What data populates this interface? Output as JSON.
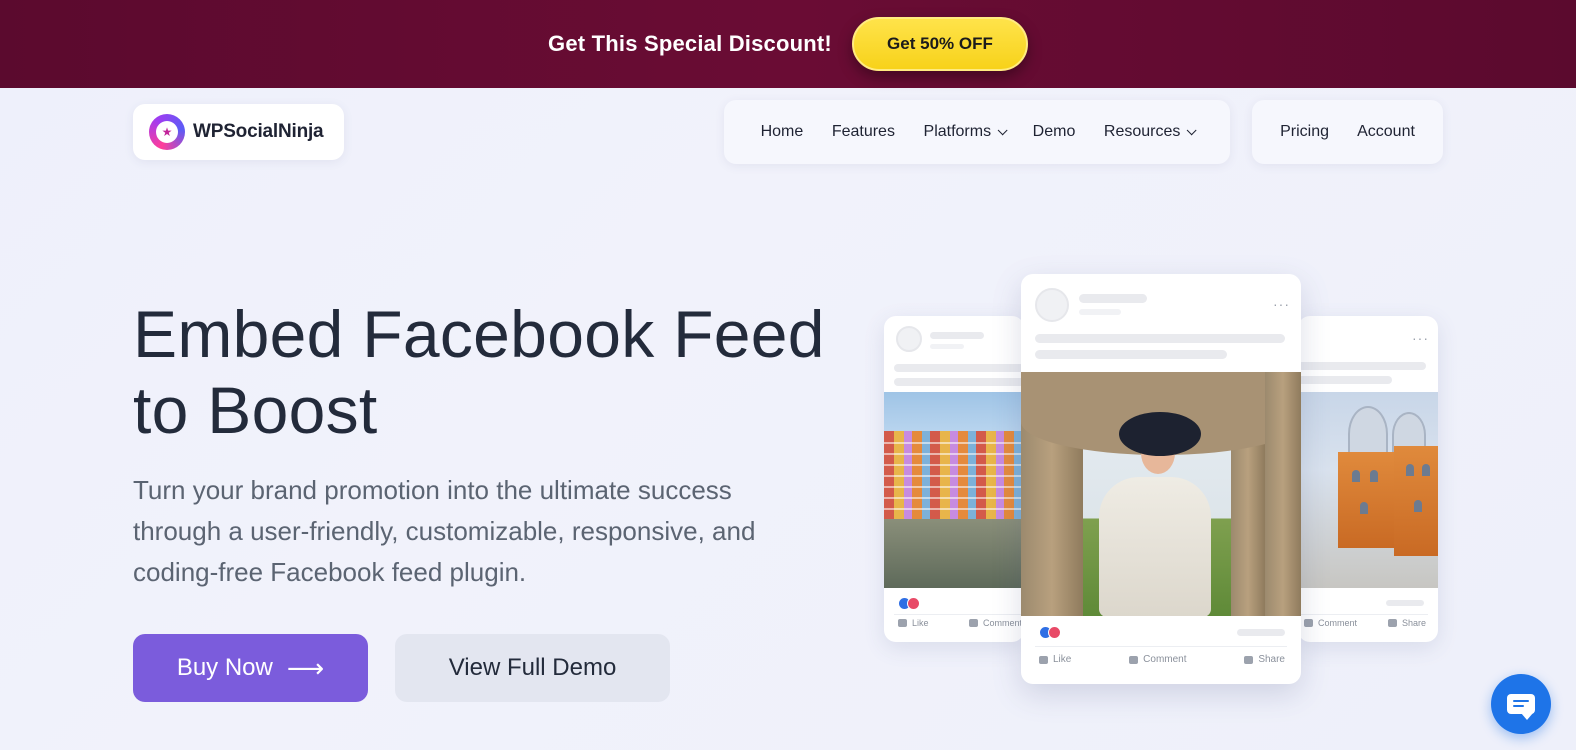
{
  "promo": {
    "text": "Get This Special Discount!",
    "button": "Get 50% OFF",
    "background_color": "#5b0a2e",
    "button_color": "#f7d21a"
  },
  "brand": {
    "name": "WPSocialNinja",
    "logo_icon": "ninja-star-icon"
  },
  "nav": {
    "main": [
      {
        "label": "Home",
        "has_dropdown": false
      },
      {
        "label": "Features",
        "has_dropdown": false
      },
      {
        "label": "Platforms",
        "has_dropdown": true
      },
      {
        "label": "Demo",
        "has_dropdown": false
      },
      {
        "label": "Resources",
        "has_dropdown": true
      }
    ],
    "side": [
      {
        "label": "Pricing"
      },
      {
        "label": "Account"
      }
    ]
  },
  "hero": {
    "title_line1": "Embed Facebook Feed",
    "title_line2": "to Boost",
    "subtitle": "Turn your brand promotion into the ultimate success through a user-friendly, customizable, responsive, and coding-free Facebook feed plugin.",
    "buy_button": "Buy Now",
    "buy_icon": "arrow-right-icon",
    "demo_button": "View Full Demo",
    "accent_color": "#7b5cdc"
  },
  "feed_preview": {
    "left": {
      "actions": [
        "Like",
        "Comment"
      ]
    },
    "center": {
      "actions": [
        "Like",
        "Comment",
        "Share"
      ]
    },
    "right": {
      "actions": [
        "Comment",
        "Share"
      ]
    }
  },
  "chat": {
    "icon": "chat-bubble-icon",
    "color": "#1e74e8"
  }
}
